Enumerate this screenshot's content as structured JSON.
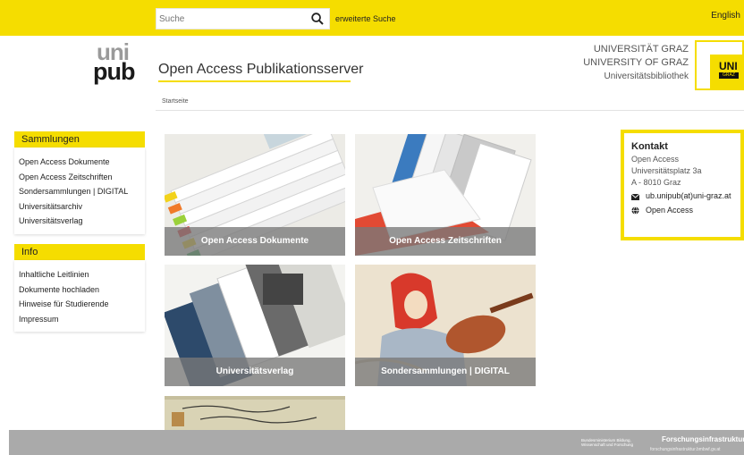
{
  "topbar": {
    "search_placeholder": "Suche",
    "advanced_search": "erweiterte Suche",
    "language": "English"
  },
  "header": {
    "logo_top": "uni",
    "logo_bottom": "pub",
    "site_title": "Open Access Publikationsserver",
    "university_de": "UNIVERSITÄT GRAZ",
    "university_en": "UNIVERSITY OF GRAZ",
    "library": "Universitätsbibliothek",
    "uni_logo_text": "UNI",
    "uni_logo_sub": "GRAZ"
  },
  "breadcrumb": "Startseite",
  "sidebar": {
    "collections_title": "Sammlungen",
    "collections": [
      "Open Access Dokumente",
      "Open Access Zeitschriften",
      "Sondersammlungen | DIGITAL",
      "Universitätsarchiv",
      "Universitätsverlag"
    ],
    "info_title": "Info",
    "info_items": [
      "Inhaltliche Leitlinien",
      "Dokumente hochladen",
      "Hinweise für Studierende",
      "Impressum"
    ]
  },
  "tiles": [
    "Open Access Dokumente",
    "Open Access Zeitschriften",
    "Universitätsverlag",
    "Sondersammlungen | DIGITAL"
  ],
  "contact": {
    "title": "Kontakt",
    "line1": "Open Access",
    "line2": "Universitätsplatz 3a",
    "line3": "A - 8010 Graz",
    "email": "ub.unipub(at)uni-graz.at",
    "web": "Open Access"
  },
  "footer": {
    "ministry": "Bundesministerium Bildung, Wissenschaft und Forschung",
    "infrastructure": "Forschungsinfrastruktur",
    "infrastructure_sub": "forschungsinfrastruktur.bmbwf.gv.at"
  },
  "colors": {
    "accent": "#f5dd00",
    "footer": "#aaaaaa",
    "caption": "#787878"
  }
}
